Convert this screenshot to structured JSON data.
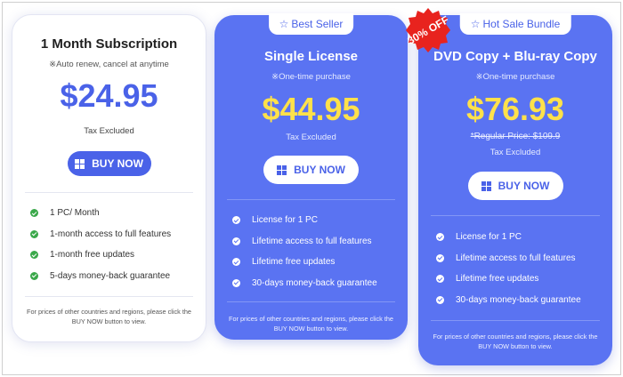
{
  "colors": {
    "accent": "#4a62e8",
    "card_blue": "#5a73f2",
    "price_yellow": "#ffe14a",
    "badge_red": "#e8231e",
    "check_green": "#3aa84a"
  },
  "plans": [
    {
      "title": "1 Month Subscription",
      "subtitle": "※Auto renew, cancel at anytime",
      "price": "$24.95",
      "tax": "Tax Excluded",
      "button": "BUY NOW",
      "features": [
        "1 PC/ Month",
        "1-month access to full features",
        "1-month free updates",
        "5-days money-back guarantee"
      ],
      "note": "For prices of other countries and regions, please click the BUY NOW button to view."
    },
    {
      "tag": "Best Seller",
      "title": "Single License",
      "subtitle": "※One-time purchase",
      "price": "$44.95",
      "tax": "Tax Excluded",
      "button": "BUY NOW",
      "features": [
        "License for 1 PC",
        "Lifetime access to full features",
        "Lifetime free updates",
        "30-days money-back guarantee"
      ],
      "note": "For prices of other countries and regions, please click the BUY NOW button to view."
    },
    {
      "tag": "Hot Sale Bundle",
      "badge": "30% OFF",
      "title": "DVD Copy + Blu-ray Copy",
      "subtitle": "※One-time purchase",
      "price": "$76.93",
      "regular_price": "*Regular Price:  $109.9",
      "tax": "Tax Excluded",
      "button": "BUY NOW",
      "features": [
        "License for 1 PC",
        "Lifetime access to full features",
        "Lifetime free updates",
        "30-days money-back guarantee"
      ],
      "note": "For prices of other countries and regions, please click the BUY NOW button to view."
    }
  ]
}
